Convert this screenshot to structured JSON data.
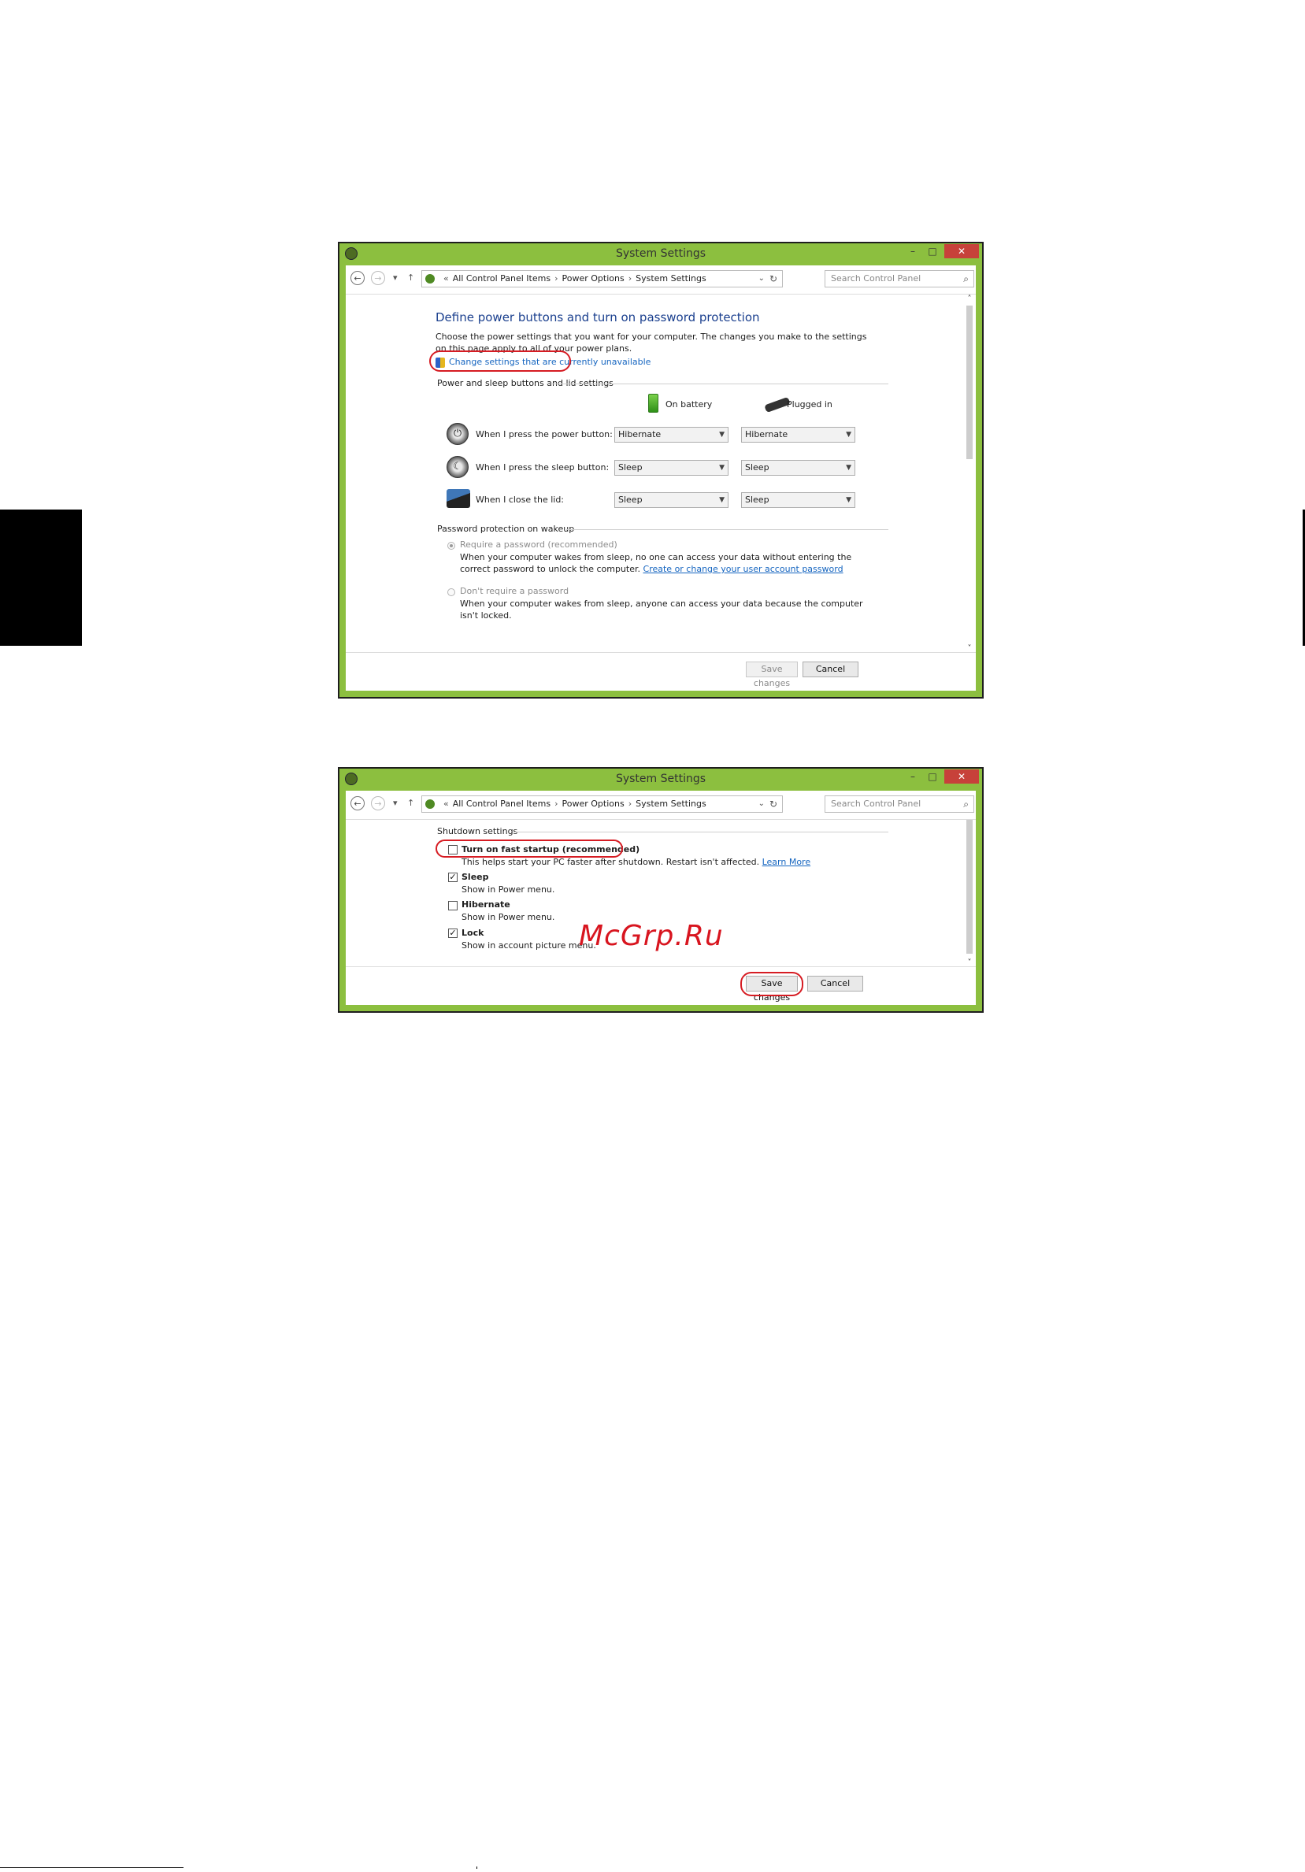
{
  "window": {
    "title": "System Settings",
    "minimize_glyph": "–",
    "maximize_glyph": "□",
    "close_glyph": "✕"
  },
  "addressbar": {
    "back_glyph": "←",
    "forward_glyph": "→",
    "recent_glyph": "▾",
    "up_glyph": "↑",
    "overflow": "«",
    "crumbs": [
      "All Control Panel Items",
      "Power Options",
      "System Settings"
    ],
    "separator": "›",
    "dropdown_glyph": "⌄",
    "refresh_glyph": "↻",
    "search_placeholder": "Search Control Panel",
    "search_glyph": "⌕"
  },
  "screen1": {
    "heading": "Define power buttons and turn on password protection",
    "description": "Choose the power settings that you want for your computer. The changes you make to the settings on this page apply to all of your power plans.",
    "change_link": "Change settings that are currently unavailable",
    "section_buttons": "Power and sleep buttons and lid settings",
    "col_battery": "On battery",
    "col_plugged": "Plugged in",
    "rows": [
      {
        "label": "When I press the power button:",
        "battery": "Hibernate",
        "plugged": "Hibernate"
      },
      {
        "label": "When I press the sleep button:",
        "battery": "Sleep",
        "plugged": "Sleep"
      },
      {
        "label": "When I close the lid:",
        "battery": "Sleep",
        "plugged": "Sleep"
      }
    ],
    "section_password": "Password protection on wakeup",
    "require_label": "Require a password (recommended)",
    "require_desc": "When your computer wakes from sleep, no one can access your data without entering the correct password to unlock the computer.",
    "require_link": "Create or change your user account password",
    "norequire_label": "Don't require a password",
    "norequire_desc": "When your computer wakes from sleep, anyone can access your data because the computer isn't locked.",
    "save_button": "Save changes",
    "cancel_button": "Cancel"
  },
  "screen2": {
    "section_shutdown": "Shutdown settings",
    "options": [
      {
        "label": "Turn on fast startup (recommended)",
        "checked": false,
        "desc": "This helps start your PC faster after shutdown. Restart isn't affected.",
        "link": "Learn More"
      },
      {
        "label": "Sleep",
        "checked": true,
        "desc": "Show in Power menu."
      },
      {
        "label": "Hibernate",
        "checked": false,
        "desc": "Show in Power menu."
      },
      {
        "label": "Lock",
        "checked": true,
        "desc": "Show in account picture menu."
      }
    ],
    "check_glyph": "✓",
    "save_button": "Save changes",
    "cancel_button": "Cancel"
  },
  "scroll": {
    "up_glyph": "˄",
    "down_glyph": "˅"
  },
  "watermark": "McGrp.Ru",
  "colors": {
    "frame_green": "#8cbf3f",
    "heading_blue": "#1a3f8e",
    "link_blue": "#1565c0",
    "annotation_red": "#d61c23",
    "close_red": "#c7413a"
  }
}
